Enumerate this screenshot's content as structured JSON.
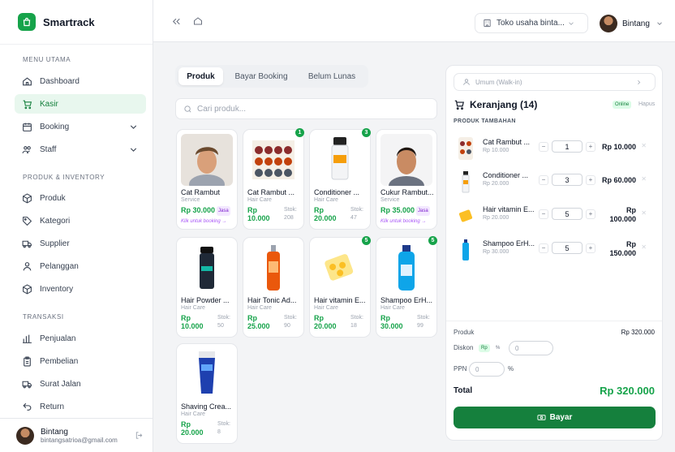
{
  "app": {
    "name": "Smartrack"
  },
  "sidebar": {
    "sections": [
      "MENU UTAMA",
      "PRODUK & INVENTORY",
      "TRANSAKSI"
    ],
    "items": [
      {
        "label": "Dashboard",
        "icon": "home-icon"
      },
      {
        "label": "Kasir",
        "icon": "cart-icon",
        "active": true
      },
      {
        "label": "Booking",
        "icon": "calendar-icon"
      },
      {
        "label": "Staff",
        "icon": "users-icon"
      },
      {
        "label": "Produk",
        "icon": "box-icon"
      },
      {
        "label": "Kategori",
        "icon": "tag-icon"
      },
      {
        "label": "Supplier",
        "icon": "truck-icon"
      },
      {
        "label": "Pelanggan",
        "icon": "user-group-icon"
      },
      {
        "label": "Inventory",
        "icon": "box-icon"
      },
      {
        "label": "Penjualan",
        "icon": "bar-chart-icon"
      },
      {
        "label": "Pembelian",
        "icon": "clipboard-icon"
      },
      {
        "label": "Surat Jalan",
        "icon": "truck-icon"
      },
      {
        "label": "Return",
        "icon": "return-icon"
      }
    ],
    "user": {
      "name": "Bintang",
      "email": "bintangsatrioa@gmail.com"
    }
  },
  "topbar": {
    "store": "Toko usaha binta...",
    "user": "Bintang"
  },
  "tabs": [
    "Produk",
    "Bayar Booking",
    "Belum Lunas"
  ],
  "search": {
    "placeholder": "Cari produk..."
  },
  "products": [
    {
      "name": "Cat Rambut",
      "category": "Service",
      "price": "Rp 30.000",
      "jasa": "Jasa",
      "note": "Klik untuk booking →"
    },
    {
      "name": "Cat Rambut ...",
      "category": "Hair Care",
      "price_a": "Rp",
      "price_b": "10.000",
      "stock_label": "Stok:",
      "stock": "208",
      "badge": "1"
    },
    {
      "name": "Conditioner ...",
      "category": "Hair Care",
      "price_a": "Rp",
      "price_b": "20.000",
      "stock_label": "Stok:",
      "stock": "47",
      "badge": "3"
    },
    {
      "name": "Cukur Rambut...",
      "category": "Service",
      "price": "Rp 35.000",
      "jasa": "Jasa",
      "note": "Klik untuk booking →"
    },
    {
      "name": "Hair Powder ...",
      "category": "Hair Care",
      "price_a": "Rp",
      "price_b": "10.000",
      "stock_label": "Stok:",
      "stock": "50"
    },
    {
      "name": "Hair Tonic Ad...",
      "category": "Hair Care",
      "price_a": "Rp",
      "price_b": "25.000",
      "stock_label": "Stok:",
      "stock": "90"
    },
    {
      "name": "Hair vitamin E...",
      "category": "Hair Care",
      "price_a": "Rp",
      "price_b": "20.000",
      "stock_label": "Stok:",
      "stock": "18",
      "badge": "5"
    },
    {
      "name": "Shampoo ErH...",
      "category": "Hair Care",
      "price_a": "Rp",
      "price_b": "30.000",
      "stock_label": "Stok:",
      "stock": "99",
      "badge": "5"
    },
    {
      "name": "Shaving Crea...",
      "category": "Hair Care",
      "price_a": "Rp",
      "price_b": "20.000",
      "stock_label": "Stok:",
      "stock": "8"
    }
  ],
  "cart": {
    "customer": "Umum (Walk-in)",
    "title": "Keranjang (14)",
    "status": "Online",
    "clear": "Hapus",
    "section": "PRODUK TAMBAHAN",
    "items": [
      {
        "name": "Cat Rambut ...",
        "price": "Rp 10.000",
        "qty": "1",
        "subtotal_a": "Rp 10.000",
        "subtotal_b": ""
      },
      {
        "name": "Conditioner ...",
        "price": "Rp 20.000",
        "qty": "3",
        "subtotal_a": "Rp 60.000",
        "subtotal_b": ""
      },
      {
        "name": "Hair vitamin E...",
        "price": "Rp 20.000",
        "qty": "5",
        "subtotal_a": "Rp",
        "subtotal_b": "100.000"
      },
      {
        "name": "Shampoo ErH...",
        "price": "Rp 30.000",
        "qty": "5",
        "subtotal_a": "Rp",
        "subtotal_b": "150.000"
      }
    ],
    "summary": {
      "produk_label": "Produk",
      "produk_value": "Rp 320.000",
      "diskon_label": "Diskon",
      "diskon_rp": "Rp",
      "diskon_pct": "%",
      "diskon_value": "0",
      "ppn_label": "PPN",
      "ppn_value": "0",
      "ppn_pct": "%",
      "total_label": "Total",
      "total_value": "Rp 320.000"
    },
    "pay_label": "Bayar"
  }
}
